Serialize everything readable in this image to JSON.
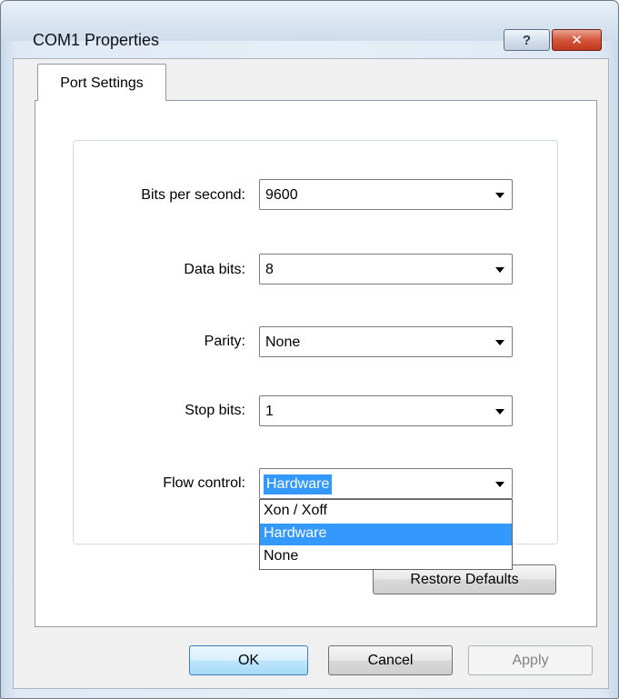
{
  "window": {
    "title": "COM1 Properties",
    "help_label": "?",
    "close_label": "✕"
  },
  "tabs": [
    {
      "label": "Port Settings",
      "selected": true
    }
  ],
  "fields": {
    "bits_per_second": {
      "label": "Bits per second:",
      "value": "9600"
    },
    "data_bits": {
      "label": "Data bits:",
      "value": "8"
    },
    "parity": {
      "label": "Parity:",
      "value": "None"
    },
    "stop_bits": {
      "label": "Stop bits:",
      "value": "1"
    },
    "flow_control": {
      "label": "Flow control:",
      "value": "Hardware",
      "options": [
        "Xon / Xoff",
        "Hardware",
        "None"
      ],
      "selected_index": 1
    }
  },
  "buttons": {
    "restore_defaults": "Restore Defaults",
    "ok": "OK",
    "cancel": "Cancel",
    "apply": "Apply"
  },
  "colors": {
    "selection": "#3399ff",
    "close_button": "#c7432a"
  }
}
